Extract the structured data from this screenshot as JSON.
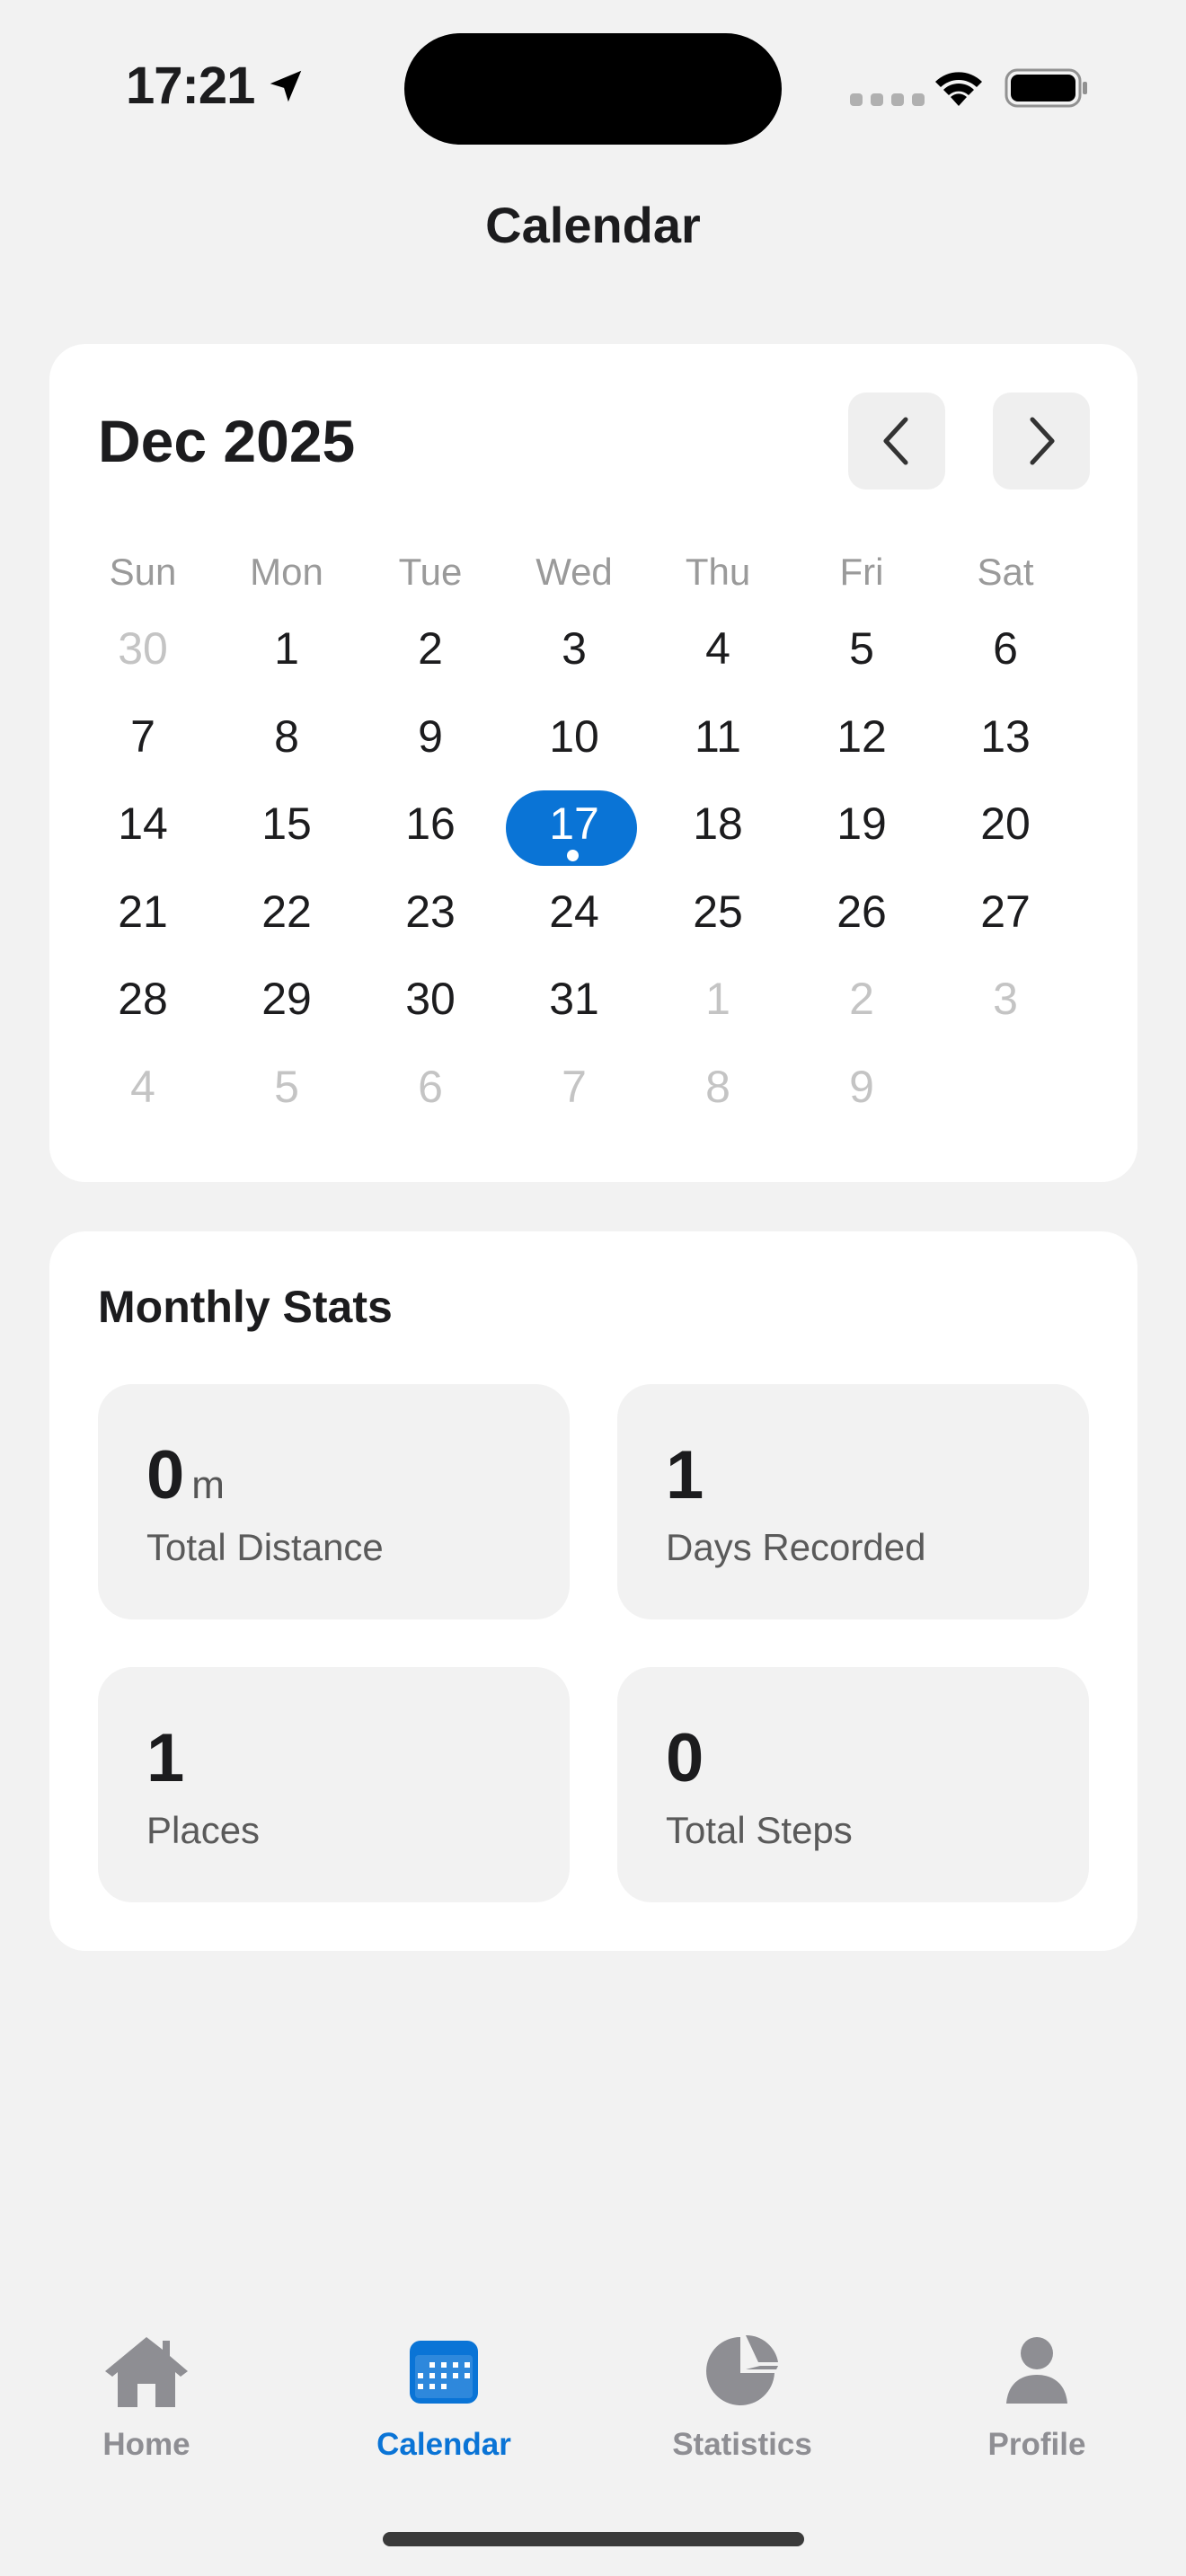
{
  "status_bar": {
    "time": "17:21"
  },
  "nav": {
    "title": "Calendar"
  },
  "calendar": {
    "month_label": "Dec 2025",
    "weekdays": [
      "Sun",
      "Mon",
      "Tue",
      "Wed",
      "Thu",
      "Fri",
      "Sat"
    ],
    "days": [
      {
        "n": "30",
        "muted": true
      },
      {
        "n": "1"
      },
      {
        "n": "2"
      },
      {
        "n": "3"
      },
      {
        "n": "4"
      },
      {
        "n": "5"
      },
      {
        "n": "6"
      },
      {
        "n": "7"
      },
      {
        "n": "8"
      },
      {
        "n": "9"
      },
      {
        "n": "10"
      },
      {
        "n": "11"
      },
      {
        "n": "12"
      },
      {
        "n": "13"
      },
      {
        "n": "14"
      },
      {
        "n": "15"
      },
      {
        "n": "16"
      },
      {
        "n": "17",
        "selected": true,
        "has_record": true
      },
      {
        "n": "18"
      },
      {
        "n": "19"
      },
      {
        "n": "20"
      },
      {
        "n": "21"
      },
      {
        "n": "22"
      },
      {
        "n": "23"
      },
      {
        "n": "24"
      },
      {
        "n": "25"
      },
      {
        "n": "26"
      },
      {
        "n": "27"
      },
      {
        "n": "28"
      },
      {
        "n": "29"
      },
      {
        "n": "30"
      },
      {
        "n": "31"
      },
      {
        "n": "1",
        "muted": true
      },
      {
        "n": "2",
        "muted": true
      },
      {
        "n": "3",
        "muted": true
      },
      {
        "n": "4",
        "muted": true
      },
      {
        "n": "5",
        "muted": true
      },
      {
        "n": "6",
        "muted": true
      },
      {
        "n": "7",
        "muted": true
      },
      {
        "n": "8",
        "muted": true
      },
      {
        "n": "9",
        "muted": true
      }
    ],
    "prev_icon": "chevron-left-icon",
    "next_icon": "chevron-right-icon"
  },
  "stats": {
    "title": "Monthly Stats",
    "total_distance": {
      "value": "0",
      "unit": "m",
      "label": "Total Distance"
    },
    "days_recorded": {
      "value": "1",
      "label": "Days Recorded"
    },
    "places": {
      "value": "1",
      "label": "Places"
    },
    "total_steps": {
      "value": "0",
      "label": "Total Steps"
    }
  },
  "tabs": [
    {
      "label": "Home",
      "icon": "house-icon"
    },
    {
      "label": "Calendar",
      "icon": "calendar-icon",
      "active": true
    },
    {
      "label": "Statistics",
      "icon": "pie-chart-icon"
    },
    {
      "label": "Profile",
      "icon": "person-icon"
    }
  ],
  "colors": {
    "accent": "#0a74d6",
    "background": "#f2f2f2",
    "card": "#ffffff"
  }
}
